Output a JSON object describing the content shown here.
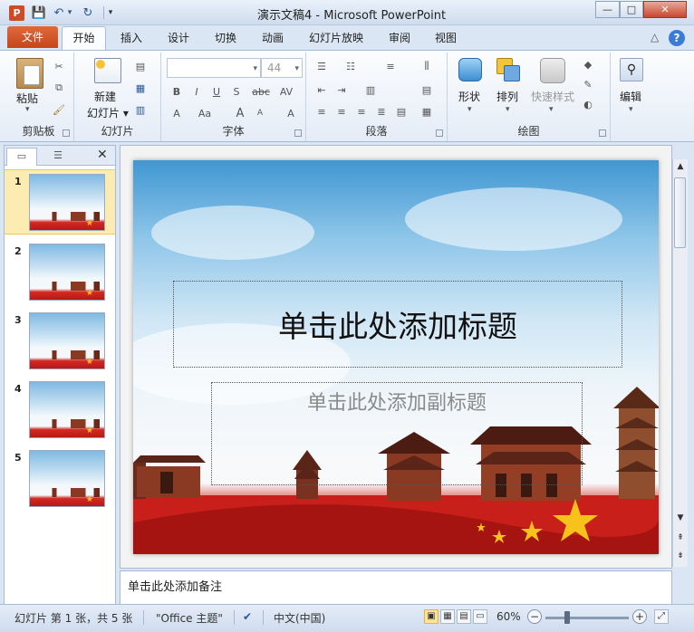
{
  "window": {
    "app_letter": "P",
    "title": "演示文稿4 - Microsoft PowerPoint",
    "min": "—",
    "max": "□",
    "close": "✕"
  },
  "qat": {
    "save": "💾",
    "undo": "↶",
    "undo_arrow": "▾",
    "redo": "↻",
    "customize": "▾"
  },
  "tabs": {
    "file": "文件",
    "items": [
      "开始",
      "插入",
      "设计",
      "切换",
      "动画",
      "幻灯片放映",
      "审阅",
      "视图"
    ],
    "help": "?",
    "minimize": "△"
  },
  "ribbon": {
    "clipboard": {
      "label": "剪贴板",
      "paste": "粘贴",
      "paste_arrow": "▾"
    },
    "slides": {
      "label": "幻灯片",
      "new_slide": "新建",
      "new_slide_2": "幻灯片 ▾"
    },
    "font": {
      "label": "字体",
      "font_name": "",
      "font_size": "44",
      "bold": "B",
      "italic": "I",
      "underline": "U",
      "shadow": "S",
      "strike": "abc",
      "spacing": "AV",
      "font_color": "A",
      "change_case": "Aa",
      "grow": "A",
      "shrink": "A",
      "clear": "A"
    },
    "paragraph": {
      "label": "段落"
    },
    "drawing": {
      "label": "绘图",
      "shapes": "形状",
      "arrange": "排列",
      "quick_styles": "快速样式",
      "shapes_arrow": "▾",
      "arrange_arrow": "▾",
      "quick_arrow": "▾"
    },
    "editing": {
      "label": "编辑",
      "arrow": "▾"
    }
  },
  "panel": {
    "tab_slides": "▭",
    "tab_outline": "☰",
    "close": "✕",
    "slide_numbers": [
      "1",
      "2",
      "3",
      "4",
      "5"
    ]
  },
  "slide": {
    "title_placeholder": "单击此处添加标题",
    "subtitle_placeholder": "单击此处添加副标题"
  },
  "notes": {
    "placeholder": "单击此处添加备注"
  },
  "status": {
    "slide_info": "幻灯片 第 1 张，共 5 张",
    "theme": "\"Office 主题\"",
    "language": "中文(中国)",
    "zoom": "60%",
    "zoom_minus": "−",
    "zoom_plus": "+"
  }
}
